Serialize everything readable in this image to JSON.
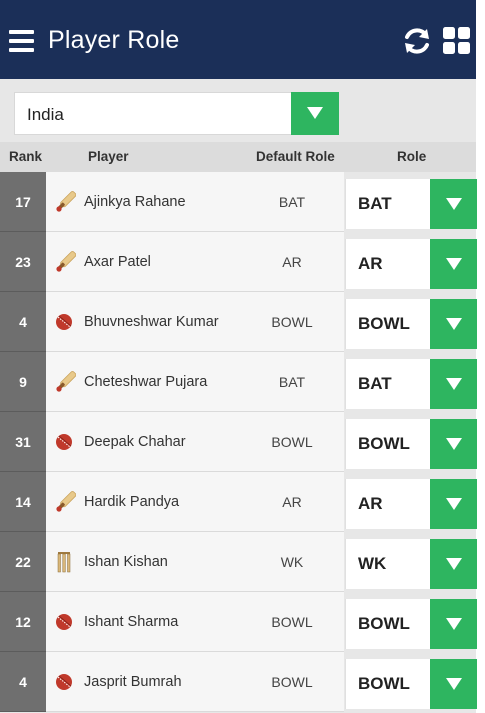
{
  "header": {
    "title": "Player Role",
    "menu_icon": "hamburger-menu-icon",
    "refresh_icon": "refresh-icon",
    "grid_icon": "grid-view-icon",
    "background": "#1b2f58"
  },
  "team_select": {
    "value": "India"
  },
  "columns": {
    "rank": "Rank",
    "player": "Player",
    "default_role": "Default Role",
    "role": "Role"
  },
  "accent": "#2eb560",
  "players": [
    {
      "rank": "17",
      "name": "Ajinkya Rahane",
      "icon": "bat",
      "default_role": "BAT",
      "role": "BAT"
    },
    {
      "rank": "23",
      "name": "Axar Patel",
      "icon": "bat",
      "default_role": "AR",
      "role": "AR"
    },
    {
      "rank": "4",
      "name": "Bhuvneshwar Kumar",
      "icon": "ball",
      "default_role": "BOWL",
      "role": "BOWL"
    },
    {
      "rank": "9",
      "name": "Cheteshwar Pujara",
      "icon": "bat",
      "default_role": "BAT",
      "role": "BAT"
    },
    {
      "rank": "31",
      "name": "Deepak Chahar",
      "icon": "ball",
      "default_role": "BOWL",
      "role": "BOWL"
    },
    {
      "rank": "14",
      "name": "Hardik Pandya",
      "icon": "bat",
      "default_role": "AR",
      "role": "AR"
    },
    {
      "rank": "22",
      "name": "Ishan Kishan",
      "icon": "stumps",
      "default_role": "WK",
      "role": "WK"
    },
    {
      "rank": "12",
      "name": "Ishant Sharma",
      "icon": "ball",
      "default_role": "BOWL",
      "role": "BOWL"
    },
    {
      "rank": "4",
      "name": "Jasprit Bumrah",
      "icon": "ball",
      "default_role": "BOWL",
      "role": "BOWL"
    }
  ]
}
